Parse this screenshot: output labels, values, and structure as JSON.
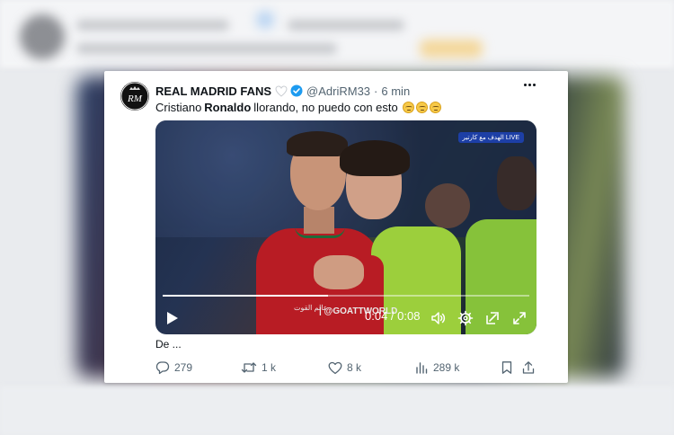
{
  "tweet": {
    "display_name": "REAL MADRID FANS",
    "handle": "@AdriRM33",
    "separator": "·",
    "time": "6 min",
    "avatar_text": "RM",
    "text_before": "Cristiano",
    "text_bold": "Ronaldo",
    "text_after": "llorando, no puedo con esto",
    "emojis": [
      "tearful-face-emoji",
      "tearful-face-emoji",
      "tearful-face-emoji"
    ],
    "truncated": "De ..."
  },
  "video": {
    "channel_badge": "الهدف مع كارتير LIVE",
    "watermark_arabic": "عالم القوت",
    "watermark": "| @GOATTWORLD",
    "current_time": "04",
    "time_display": "0:04 / 0:08",
    "progress": 0.45,
    "controls": [
      "play-icon",
      "volume-icon",
      "settings-icon",
      "pip-icon",
      "fullscreen-icon"
    ]
  },
  "actions": {
    "replies": "279",
    "retweets": "1 k",
    "likes": "8 k",
    "views": "289 k"
  },
  "colors": {
    "text_primary": "#0f1419",
    "text_secondary": "#536471",
    "verified_blue": "#1d9bf0"
  }
}
